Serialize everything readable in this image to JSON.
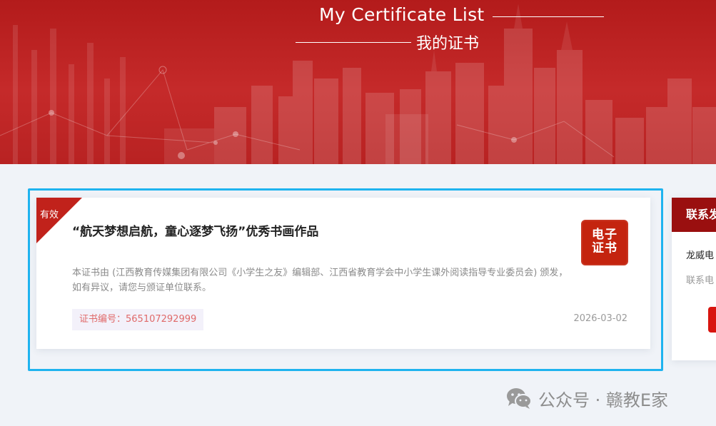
{
  "banner": {
    "title_en": "My Certificate List",
    "title_cn": "我的证书"
  },
  "certificate": {
    "status": "有效",
    "title": "“航天梦想启航，童心逐梦飞扬”优秀书画作品",
    "description_line1": "本证书由 (江西教育传媒集团有限公司《小学生之友》编辑部、江西省教育学会中小学生课外阅读指导专业委员会) 颁发，",
    "description_line2": "如有异议，请您与颁证单位联系。",
    "number_label": "证书编号：565107292999",
    "date": "2026-03-02",
    "badge_line1": "电子",
    "badge_line2": "证书"
  },
  "side_panel": {
    "header": "联系发",
    "company": "龙威电",
    "phone": "联系电"
  },
  "watermark": {
    "text": "公众号 · 赣教E家",
    "icon": "wechat-icon"
  },
  "colors": {
    "banner_red": "#b31b1b",
    "ribbon_red": "#c1221b",
    "focus_blue": "#1fb3ef",
    "badge_red": "#c4240f",
    "side_header": "#9a0f0f"
  }
}
